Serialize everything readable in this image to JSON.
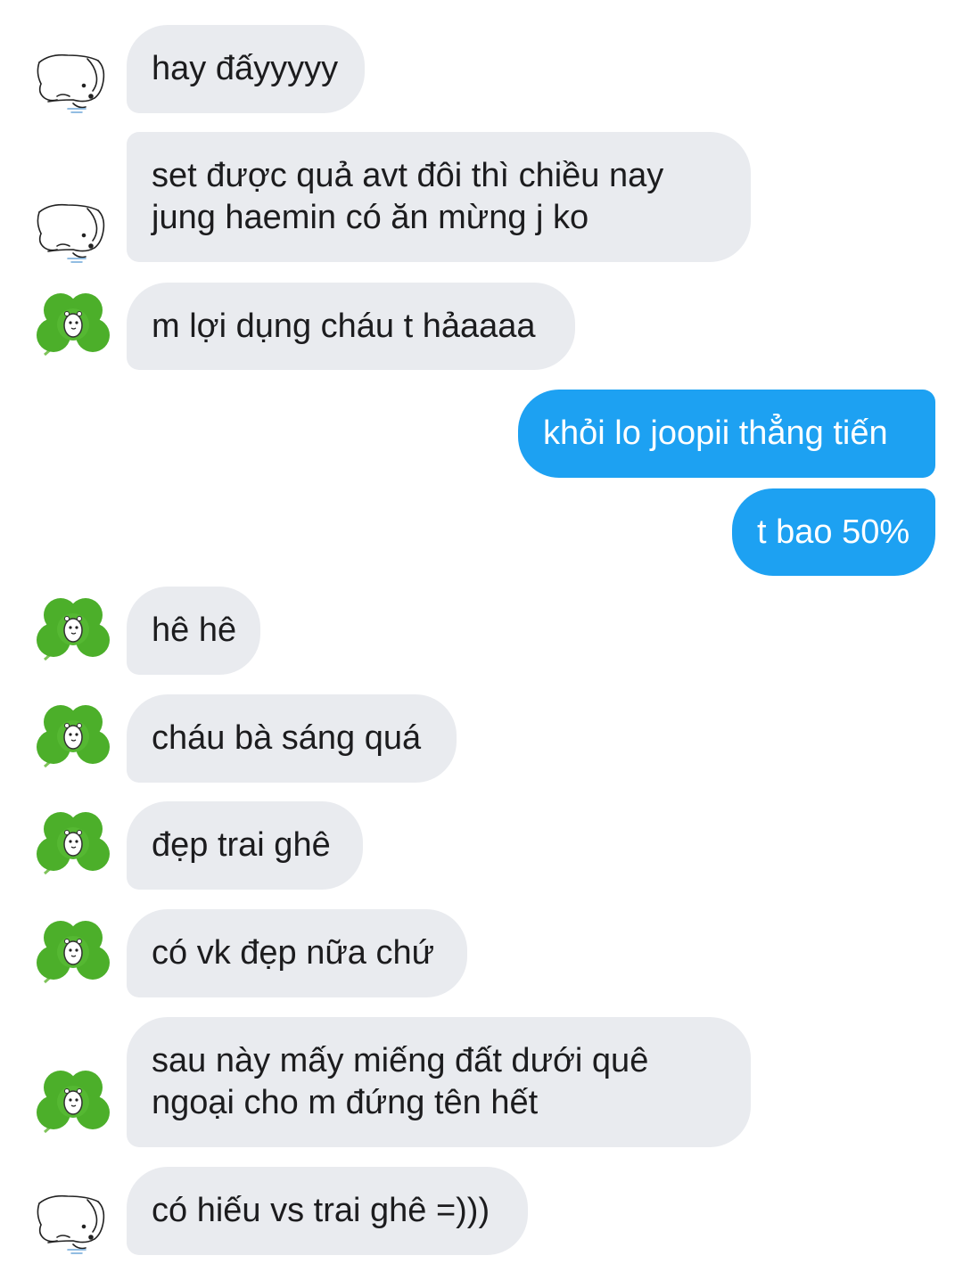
{
  "colors": {
    "incoming_bg": "#e9ebef",
    "outgoing_bg": "#1da1f2",
    "clover": "#4caf2a"
  },
  "messages": [
    {
      "sender": "friend-dog",
      "avatar": "dog-sketch-icon",
      "text": "hay đấyyyyy"
    },
    {
      "sender": "friend-dog",
      "avatar": "dog-sketch-icon",
      "lines": [
        "set được quả avt đôi thì chiều nay",
        "jung haemin có ăn mừng j ko"
      ]
    },
    {
      "sender": "friend-clover",
      "avatar": "clover-icon",
      "text": "m lợi dụng cháu t hảaaaa"
    },
    {
      "sender": "me",
      "text": "khỏi lo joopii thẳng tiến"
    },
    {
      "sender": "me",
      "text": "t bao 50%"
    },
    {
      "sender": "friend-clover",
      "avatar": "clover-icon",
      "text": "hê hê"
    },
    {
      "sender": "friend-clover",
      "avatar": "clover-icon",
      "text": "cháu bà sáng quá"
    },
    {
      "sender": "friend-clover",
      "avatar": "clover-icon",
      "text": "đẹp trai ghê"
    },
    {
      "sender": "friend-clover",
      "avatar": "clover-icon",
      "text": "có vk đẹp nữa chứ"
    },
    {
      "sender": "friend-clover",
      "avatar": "clover-icon",
      "lines": [
        "sau này mấy miếng đất dưới quê",
        "ngoại cho m đứng tên hết"
      ]
    },
    {
      "sender": "friend-dog",
      "avatar": "dog-sketch-icon",
      "text": "có hiếu vs trai ghê =)))"
    }
  ]
}
